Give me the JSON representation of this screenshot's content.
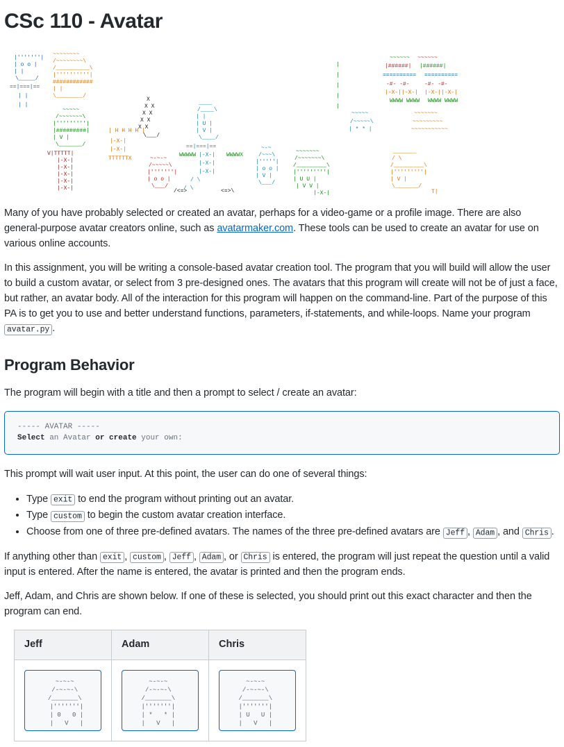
{
  "title": "CSc 110 - Avatar",
  "intro": {
    "p1a": "Many of you have probably selected or created an avatar, perhaps for a video-game or a profile image. There are also general-purpose avatar creators online, such as ",
    "link": "avatarmaker.com",
    "p1b": ". These tools can be used to create an avatar for use on various online accounts.",
    "p2a": "In this assignment, you will be writing a console-based avatar creation tool. The program that you will build will allow the user to build a custom avatar, or select from 3 pre-designed ones. The avatars that this program will create will not be of just a face, but rather, an avatar body. All of the interaction for this program will happen on the command-line. Part of the purpose of this PA is to get you to use and better understand functions, parameters, if-statements, and while-loops. Name your program ",
    "code_program": "avatar.py",
    "p2b": "."
  },
  "behavior": {
    "heading": "Program Behavior",
    "intro": "The program will begin with a title and then a prompt to select / create an avatar:",
    "code_line1": "----- AVATAR -----",
    "code_select": "Select",
    "code_an": " an Avatar ",
    "code_or": "or",
    "code_create": " create",
    "code_rest": " your own:",
    "after_code": "This prompt will wait user input. At this point, the user can do one of several things:",
    "bullets": {
      "b1a": "Type ",
      "exit": "exit",
      "b1b": " to end the program without printing out an avatar.",
      "b2a": "Type ",
      "custom": "custom",
      "b2b": " to begin the custom avatar creation interface.",
      "b3a": "Choose from one of three pre-defined avatars. The names of the three pre-defined avatars are ",
      "jeff": "Jeff",
      "b3b": ", ",
      "adam": "Adam",
      "b3c": ", and ",
      "chris": "Chris",
      "b3d": "."
    },
    "p_anything_a": "If anything other than ",
    "p_anything_b": ", ",
    "p_anything_c": ", ",
    "p_anything_d": ", ",
    "p_anything_e": ", or ",
    "p_anything_f": " is entered, the program will just repeat the question until a valid input is entered. After the name is entered, the avatar is printed and then the program ends.",
    "p_shown": "Jeff, Adam, and Chris are shown below. If one of these is selected, you should print out this exact character and then the program can end."
  },
  "table": {
    "h1": "Jeff",
    "h2": "Adam",
    "h3": "Chris",
    "jeff_art": "    ~-~-~   \n   /-~-~-\\  \n  /_______\\ \n  |'''''''|\n  | 0   0 |\n  |   V   |",
    "adam_art": "   ~-~-~    \n  /-~-~-\\   \n /_______\\  \n |'''''''|  \n | *   * |  \n |   V   |  ",
    "chris_art": "   ~-~-~    \n  /-~-~-\\   \n /_______\\  \n |'''''''|  \n | U   U |  \n |   V   |  "
  }
}
